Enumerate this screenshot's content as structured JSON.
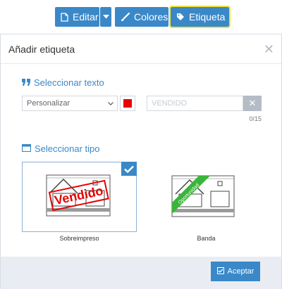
{
  "toolbar": {
    "editar_label": "Editar",
    "colores_label": "Colores",
    "etiqueta_label": "Etiqueta"
  },
  "modal": {
    "title": "Añadir etiqueta",
    "texto_section_title": "Seleccionar texto",
    "select_value": "Personalizar",
    "color": "#e80000",
    "text_placeholder": "VENDIDO",
    "counter": "0/15",
    "tipo_section_title": "Seleccionar tipo",
    "cards": [
      {
        "label": "Sobreimpreso",
        "stamp_text": "Vendido",
        "selected": true
      },
      {
        "label": "Banda",
        "stamp_text": "Oportunidad",
        "selected": false
      }
    ],
    "accept_label": "Aceptar"
  },
  "colors": {
    "accent": "#3a88c8",
    "highlight": "#f2e23a",
    "stamp_red": "#e80000",
    "band_green": "#3ab53a"
  }
}
